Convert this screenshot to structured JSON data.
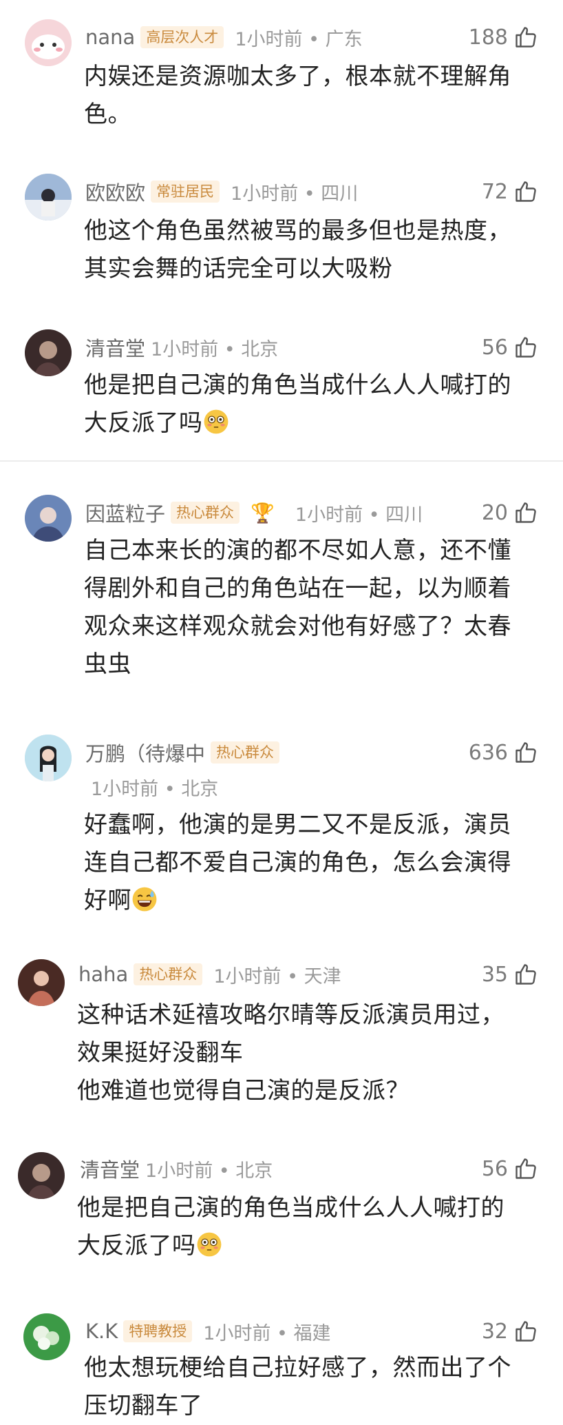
{
  "comments": [
    {
      "name": "nana",
      "badge": "高层次人才",
      "meta": "1小时前 • 广东",
      "likes": "188",
      "lines": [
        "内娱还是资源咖太多了，根本就不理解角",
        "色。"
      ]
    },
    {
      "name": "欧欧欧",
      "badge": "常驻居民",
      "meta": "1小时前 • 四川",
      "likes": "72",
      "lines": [
        "他这个角色虽然被骂的最多但也是热度，",
        "其实会舞的话完全可以大吸粉"
      ]
    },
    {
      "name": "清音堂",
      "badge": "",
      "meta": "1小时前 • 北京",
      "likes": "56",
      "lines": [
        "他是把自己演的角色当成什么人人喊打的",
        "大反派了吗"
      ]
    },
    {
      "name": "因蓝粒子",
      "badge": "热心群众",
      "meta": "1小时前 • 四川",
      "likes": "20",
      "lines": [
        "自己本来长的演的都不尽如人意，还不懂",
        "得剧外和自己的角色站在一起，以为顺着",
        "观众来这样观众就会对他有好感了？太春",
        "虫虫"
      ]
    },
    {
      "name": "万鹏（待爆中",
      "badge": "热心群众",
      "meta": "1小时前 • 北京",
      "likes": "636",
      "lines": [
        "好蠢啊，他演的是男二又不是反派，演员",
        "连自己都不爱自己演的角色，怎么会演得",
        "好啊"
      ]
    },
    {
      "name": "haha",
      "badge": "热心群众",
      "meta": "1小时前 • 天津",
      "likes": "35",
      "lines": [
        "这种话术延禧攻略尔晴等反派演员用过，",
        "效果挺好没翻车",
        "他难道也觉得自己演的是反派？"
      ]
    },
    {
      "name": "清音堂",
      "badge": "",
      "meta": "1小时前 • 北京",
      "likes": "56",
      "lines": [
        "他是把自己演的角色当成什么人人喊打的",
        "大反派了吗"
      ]
    },
    {
      "name": "K.K",
      "badge": "特聘教授",
      "meta": "1小时前 • 福建",
      "likes": "32",
      "lines": [
        "他太想玩梗给自己拉好感了，然而出了个",
        "压切翻车了"
      ]
    }
  ],
  "icons": {
    "like": "thumbs-up-icon",
    "trophy": "trophy-icon",
    "flushed": "flushed-face-emoji",
    "sweat": "grinning-sweat-emoji"
  },
  "colors": {
    "badge_bg": "#fdf1e1",
    "badge_text": "#c98a3d",
    "meta": "#9a9a9a",
    "text": "#222222"
  }
}
